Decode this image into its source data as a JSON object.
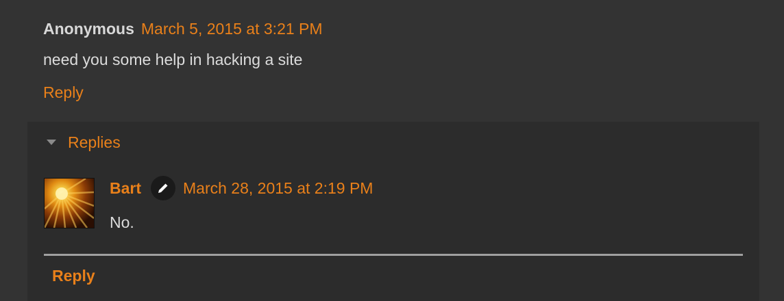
{
  "comment": {
    "author": "Anonymous",
    "timestamp": "March 5, 2015 at 3:21 PM",
    "body": "need you some help in hacking a site",
    "reply_label": "Reply"
  },
  "replies": {
    "toggle_label": "Replies",
    "items": [
      {
        "author": "Bart",
        "author_badge_icon": "pencil-icon",
        "timestamp": "March 28, 2015 at 2:19 PM",
        "body": "No."
      }
    ],
    "reply_button_label": "Reply"
  },
  "colors": {
    "background": "#333333",
    "replies_background": "#2c2c2c",
    "accent": "#e9801a",
    "text": "#dcdcdc"
  }
}
